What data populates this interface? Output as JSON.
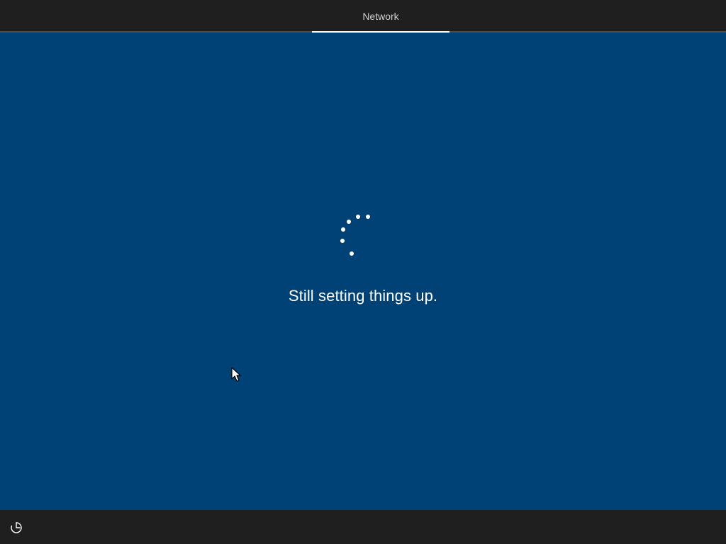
{
  "header": {
    "active_step": "Network"
  },
  "main": {
    "status_message": "Still setting things up."
  },
  "footer": {
    "ease_of_access_icon": "ease-of-access-icon"
  },
  "colors": {
    "background": "#004275",
    "bars": "#1f1f1f",
    "text": "#ffffff",
    "tab_text": "#cfcfcf"
  }
}
